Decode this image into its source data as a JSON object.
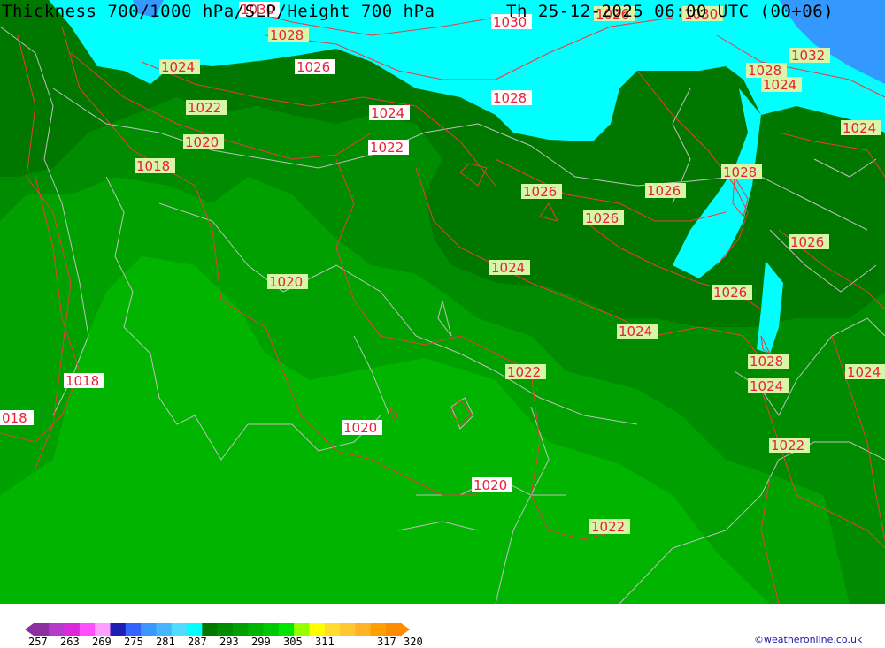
{
  "title": "Thickness 700/1000 hPa/SLP/Height 700 hPa",
  "valid_time": "Th 25-12-2025 06:00 UTC (00+06)",
  "credit": "©weatheronline.co.uk",
  "colors": {
    "thickness_281": "#00ffff",
    "thickness_275": "#3399ff",
    "thickness_287": "#007800",
    "thickness_290": "#008c00",
    "thickness_293": "#00a000",
    "thickness_296": "#00b400",
    "isobar": "#e83c3c",
    "coastline": "#bfbfbf"
  },
  "legend": {
    "ticks": [
      "257",
      "263",
      "269",
      "275",
      "281",
      "287",
      "293",
      "299",
      "305",
      "311",
      "317",
      "320"
    ],
    "swatches": [
      "#8c2fa0",
      "#b43cc8",
      "#dc28dc",
      "#ff50ff",
      "#ffa0ff",
      "#1e1eb4",
      "#3264ff",
      "#3c96ff",
      "#46b4ff",
      "#50dcff",
      "#00ffff",
      "#007800",
      "#008c00",
      "#00a000",
      "#00b400",
      "#00c800",
      "#00e600",
      "#96ff00",
      "#ffff00",
      "#ffdc32",
      "#ffc832",
      "#ffb428",
      "#ffa000",
      "#ff8c00"
    ]
  },
  "isobar_labels": [
    {
      "text": "1030",
      "style": "light"
    },
    {
      "text": "1028",
      "style": "box"
    },
    {
      "text": "1030",
      "style": "light"
    },
    {
      "text": "1026",
      "style": "box"
    },
    {
      "text": "1030",
      "style": "box"
    },
    {
      "text": "1032",
      "style": "box"
    },
    {
      "text": "1024",
      "style": "box"
    },
    {
      "text": "1026",
      "style": "light"
    },
    {
      "text": "1028",
      "style": "box"
    },
    {
      "text": "1024",
      "style": "box"
    },
    {
      "text": "1028",
      "style": "light"
    },
    {
      "text": "1022",
      "style": "box"
    },
    {
      "text": "1024",
      "style": "light"
    },
    {
      "text": "1024",
      "style": "box"
    },
    {
      "text": "1020",
      "style": "box"
    },
    {
      "text": "1022",
      "style": "light"
    },
    {
      "text": "1018",
      "style": "box"
    },
    {
      "text": "1028",
      "style": "box"
    },
    {
      "text": "1026",
      "style": "box"
    },
    {
      "text": "1026",
      "style": "box"
    },
    {
      "text": "1026",
      "style": "box"
    },
    {
      "text": "1026",
      "style": "box"
    },
    {
      "text": "1024",
      "style": "box"
    },
    {
      "text": "1020",
      "style": "box"
    },
    {
      "text": "1026",
      "style": "box"
    },
    {
      "text": "1024",
      "style": "box"
    },
    {
      "text": "1028",
      "style": "box"
    },
    {
      "text": "1024",
      "style": "box"
    },
    {
      "text": "1024",
      "style": "box"
    },
    {
      "text": "1018",
      "style": "light"
    },
    {
      "text": "1022",
      "style": "box"
    },
    {
      "text": "018",
      "style": "light"
    },
    {
      "text": "1020",
      "style": "light"
    },
    {
      "text": "1022",
      "style": "box"
    },
    {
      "text": "1020",
      "style": "light"
    },
    {
      "text": "1022",
      "style": "box"
    }
  ]
}
